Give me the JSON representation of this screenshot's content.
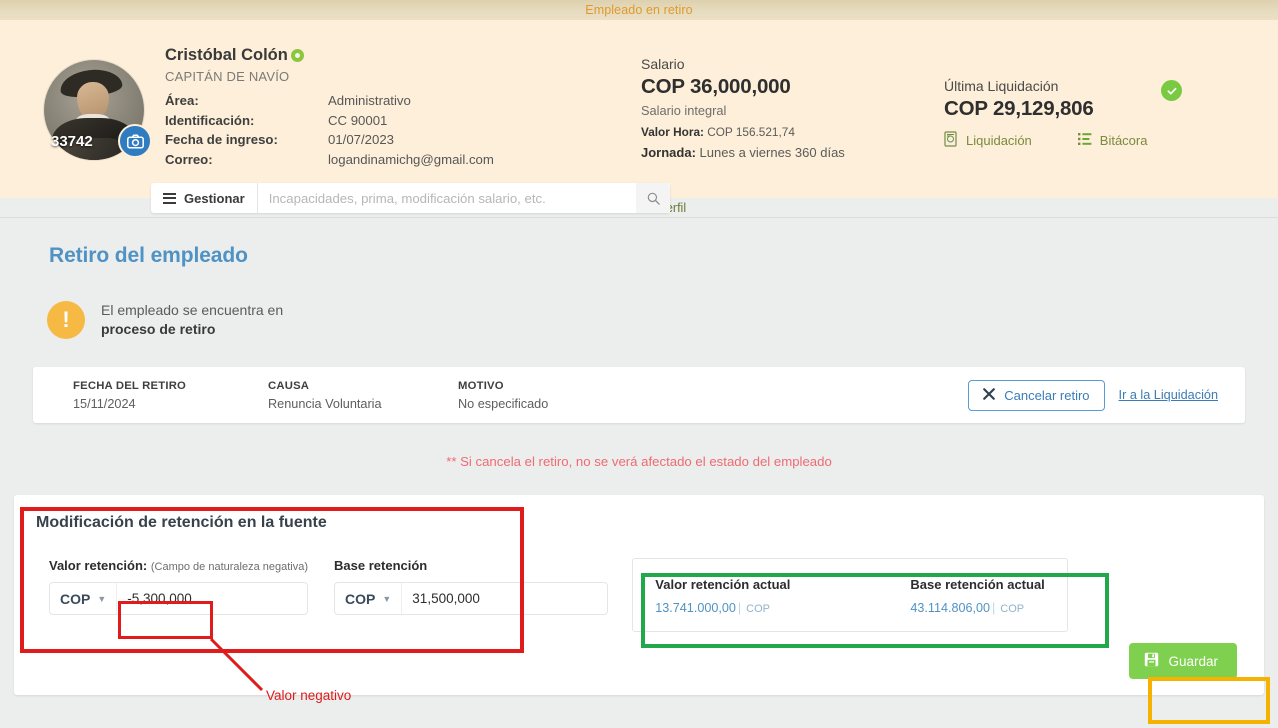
{
  "banner": {
    "text": "Empleado en retiro"
  },
  "profile": {
    "avatar": {
      "employee_id": "33742",
      "camera_icon": "camera-icon",
      "portrait_alt": "Cristóbal Colón portrait"
    },
    "name": "Cristóbal Colón",
    "verified_icon": "verified-eye-icon",
    "role": "CAPITÁN DE NAVÍO",
    "fields": [
      {
        "label": "Área:",
        "value": "Administrativo"
      },
      {
        "label": "Identificación:",
        "value": "CC 90001"
      },
      {
        "label": "Fecha de ingreso:",
        "value": "01/07/2023"
      },
      {
        "label": "Correo:",
        "value": "logandinamichg@gmail.com"
      }
    ],
    "salary": {
      "title": "Salario",
      "amount": "COP 36,000,000",
      "subtitle": "Salario integral",
      "hour_label": "Valor Hora:",
      "hour_value": "COP 156.521,74",
      "workday_label": "Jornada:",
      "workday_value": "Lunes a viernes 360 días"
    },
    "liquidacion": {
      "title": "Última Liquidación",
      "amount": "COP 29,129,806",
      "status_icon": "check-circle-icon",
      "links": [
        {
          "label": "Liquidación",
          "icon": "document-money-icon"
        },
        {
          "label": "Bitácora",
          "icon": "list-log-icon"
        }
      ]
    },
    "gestionar": {
      "button_label": "Gestionar",
      "menu_icon": "hamburger-icon",
      "search_placeholder": "Incapacidades, prima, modificación salario, etc.",
      "search_value": "",
      "search_icon": "search-icon"
    },
    "hide_profile": {
      "label": "Ocultar Perfil",
      "icon": "chevron-up-icon"
    }
  },
  "page": {
    "title": "Retiro del empleado",
    "alert": {
      "icon": "exclamation-icon",
      "line1": "El empleado se encuentra en",
      "line2": "proceso de retiro"
    },
    "retiro_card": {
      "columns": [
        {
          "header": "FECHA DEL RETIRO",
          "value": "15/11/2024"
        },
        {
          "header": "CAUSA",
          "value": "Renuncia Voluntaria"
        },
        {
          "header": "MOTIVO",
          "value": "No especificado"
        }
      ],
      "cancel_button": {
        "label": "Cancelar retiro",
        "icon": "close-x-icon"
      },
      "liquidacion_link": "Ir a la Liquidación"
    },
    "cancel_note": "** Si cancela el retiro, no se verá afectado el estado del empleado",
    "form": {
      "title": "Modificación de retención en la fuente",
      "valor_retencion": {
        "label": "Valor retención:",
        "hint": "(Campo de naturaleza negativa)",
        "currency": "COP",
        "value": "-5,300,000"
      },
      "base_retencion": {
        "label": "Base retención",
        "currency": "COP",
        "value": "31,500,000"
      },
      "actual": {
        "valor": {
          "header": "Valor retención actual",
          "value": "13.741.000,00",
          "currency": "COP"
        },
        "base": {
          "header": "Base retención actual",
          "value": "43.114.806,00",
          "currency": "COP"
        }
      },
      "save_button": {
        "label": "Guardar",
        "icon": "save-floppy-icon"
      }
    }
  },
  "annotations": {
    "negative_value_label": "Valor negativo",
    "red": "#e01b1b",
    "green": "#22a84a",
    "yellow": "#f5b200"
  },
  "colors": {
    "banner_text": "#e09a2a",
    "header_bg": "#fdefd9",
    "page_title": "#4f92c4",
    "accent_blue": "#3b7cb5",
    "save_green": "#7ed04e",
    "warn_orange": "#f5b944",
    "note_red": "#ef6b72"
  }
}
